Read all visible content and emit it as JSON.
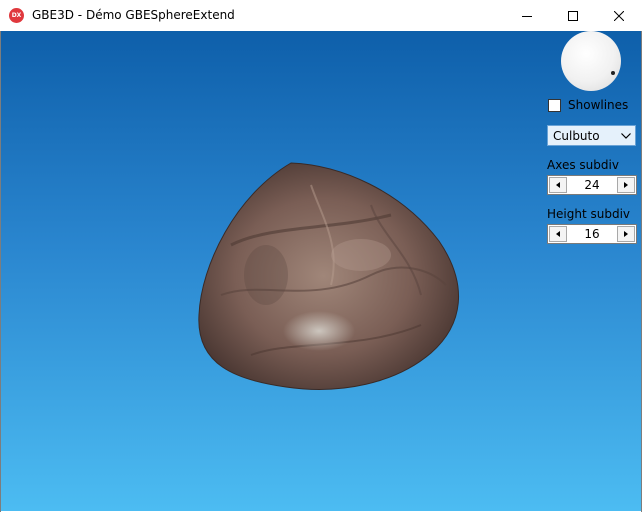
{
  "window": {
    "title": "GBE3D - Démo GBESphereExtend",
    "icon_label": "DX"
  },
  "controls": {
    "showlines_label": "Showlines",
    "showlines_checked": false,
    "mode_select_value": "Culbuto",
    "axes_subdiv_label": "Axes subdiv",
    "axes_subdiv_value": "24",
    "height_subdiv_label": "Height subdiv",
    "height_subdiv_value": "16"
  },
  "colors": {
    "background_top": "#0e5faa",
    "background_bottom": "#4cbcf2",
    "rock": "#7a5e55"
  }
}
